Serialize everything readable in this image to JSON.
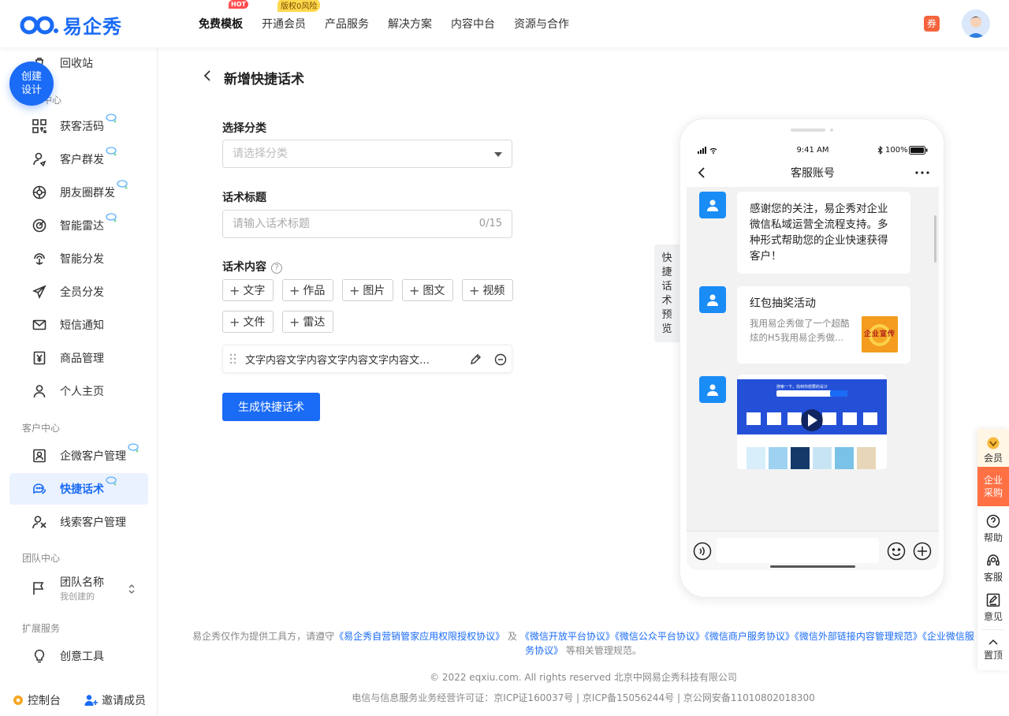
{
  "brand": {
    "logo_text": "易企秀"
  },
  "topnav": {
    "items": [
      {
        "label": "免费模板",
        "badge": "HOT"
      },
      {
        "label": "开通会员",
        "badge": "版权0风险"
      },
      {
        "label": "产品服务"
      },
      {
        "label": "解决方案"
      },
      {
        "label": "内容中台"
      },
      {
        "label": "资源与合作"
      }
    ],
    "coupon_label": "券"
  },
  "sidebar": {
    "create_button": "创建\n设计",
    "recycle": "回收站",
    "group_marketing_tail": "中心",
    "marketing_items": [
      {
        "label": "获客活码",
        "icon": "qrcode-icon",
        "new": true
      },
      {
        "label": "客户群发",
        "icon": "user-send-icon",
        "new": true
      },
      {
        "label": "朋友圈群发",
        "icon": "moments-icon",
        "new": true
      },
      {
        "label": "智能雷达",
        "icon": "radar-icon",
        "new": true
      },
      {
        "label": "智能分发",
        "icon": "distribute-icon"
      },
      {
        "label": "全员分发",
        "icon": "paper-plane-icon"
      },
      {
        "label": "短信通知",
        "icon": "mail-icon"
      },
      {
        "label": "商品管理",
        "icon": "yen-icon"
      },
      {
        "label": "个人主页",
        "icon": "person-icon"
      }
    ],
    "group_customer": "客户中心",
    "customer_items": [
      {
        "label": "企微客户管理",
        "icon": "contact-card-icon",
        "new": true
      },
      {
        "label": "快捷话术",
        "icon": "chat-bubbles-icon",
        "new": true,
        "active": true
      },
      {
        "label": "线索客户管理",
        "icon": "users-icon"
      }
    ],
    "group_team": "团队中心",
    "team": {
      "name": "团队名称",
      "sub": "我创建的"
    },
    "group_extend": "扩展服务",
    "extend_items": [
      {
        "label": "创意工具",
        "icon": "bulb-icon"
      }
    ],
    "bottom": {
      "console": "控制台",
      "invite": "邀请成员"
    }
  },
  "form": {
    "title": "新增快捷话术",
    "category_label": "选择分类",
    "category_placeholder": "请选择分类",
    "title_label": "话术标题",
    "title_placeholder": "请输入话术标题",
    "title_counter": "0/15",
    "content_label": "话术内容",
    "help": "?",
    "content_types": [
      "文字",
      "作品",
      "图片",
      "图文",
      "视频",
      "文件",
      "雷达"
    ],
    "content_item_text": "文字内容文字内容文字内容文字内容文字...",
    "submit": "生成快捷话术"
  },
  "preview_tab": [
    "快",
    "捷",
    "话",
    "术",
    "预",
    "览"
  ],
  "phone": {
    "time": "9:41 AM",
    "battery": "100%",
    "chat_title": "客服账号",
    "message_text": "感谢您的关注，易企秀对企业微信私域运营全流程支持。多种形式帮助您的企业快速获得客户！",
    "card_title": "红包抽奖活动",
    "card_desc": "我用易企秀做了一个超酷炫的H5我用易企秀做...",
    "card_thumb_text": "企业宣传",
    "video_search_text": "搜索一下，找到你想要的设计"
  },
  "footer": {
    "line1_prefix": "易企秀仅作为提供工具方，请遵守",
    "link1": "《易企秀自营销管家应用权限授权协议》",
    "and": "及",
    "link2": "《微信开放平台协议》《微信公众平台协议》《微信商户服务协议》《微信外部链接内容管理规范》《企业微信服务协议》",
    "line1_suffix": "等相关管理规范。",
    "copyright": "© 2022 eqxiu.com. All rights reserved 北京中网易企秀科技有限公司",
    "license": "电信与信息服务业务经营许可证：京ICP证160037号 | 京ICP备15056244号 | 京公网安备11010802018300"
  },
  "floatbar": {
    "vip": "会员",
    "purchase": "企业\n采购",
    "help": "帮助",
    "service": "客服",
    "feedback": "意见",
    "top": "置顶"
  },
  "colors": {
    "primary": "#1a6bf5",
    "accent": "#ff7045",
    "coupon": "#f5643c"
  }
}
